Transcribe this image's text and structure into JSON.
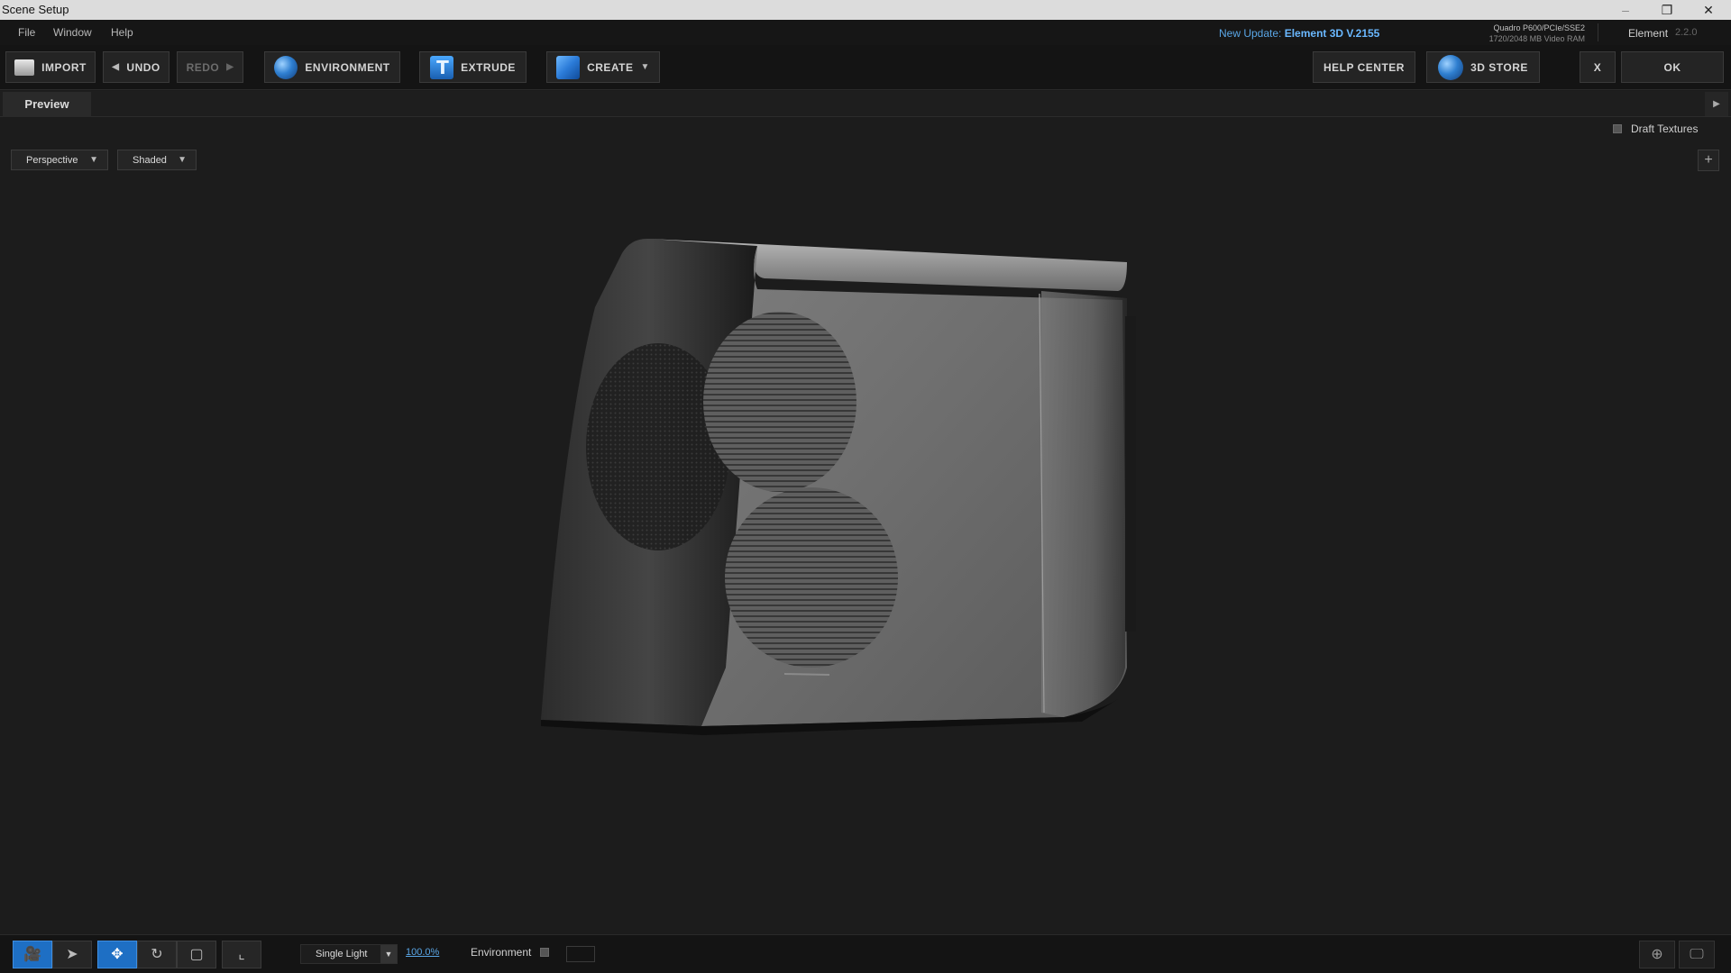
{
  "window": {
    "title": "Scene Setup",
    "controls": {
      "minimize": "–",
      "restore": "❐",
      "close": "✕"
    }
  },
  "menubar": {
    "items": [
      "File",
      "Window",
      "Help"
    ],
    "update_prefix": "New Update:",
    "update_version": "Element 3D V.2155",
    "gpu_line1": "Quadro P600/PCIe/SSE2",
    "gpu_line2": "1720/2048 MB Video RAM",
    "product_name": "Element",
    "product_version": "2.2.0"
  },
  "toolbar": {
    "import": "IMPORT",
    "undo": "UNDO",
    "redo": "REDO",
    "environment": "ENVIRONMENT",
    "extrude": "EXTRUDE",
    "create": "CREATE",
    "help_center": "HELP CENTER",
    "store": "3D STORE",
    "close": "X",
    "ok": "OK"
  },
  "tabs": {
    "preview": "Preview"
  },
  "viewport": {
    "draft_textures": "Draft Textures",
    "draft_textures_checked": false,
    "view_mode": "Perspective",
    "shading_mode": "Shaded"
  },
  "bottombar": {
    "light_mode": "Single Light",
    "light_intensity": "100.0%",
    "environment_label": "Environment",
    "environment_checked": false
  },
  "colors": {
    "accent": "#1e6fc4",
    "link": "#5aa6e6",
    "background": "#1c1c1c"
  }
}
